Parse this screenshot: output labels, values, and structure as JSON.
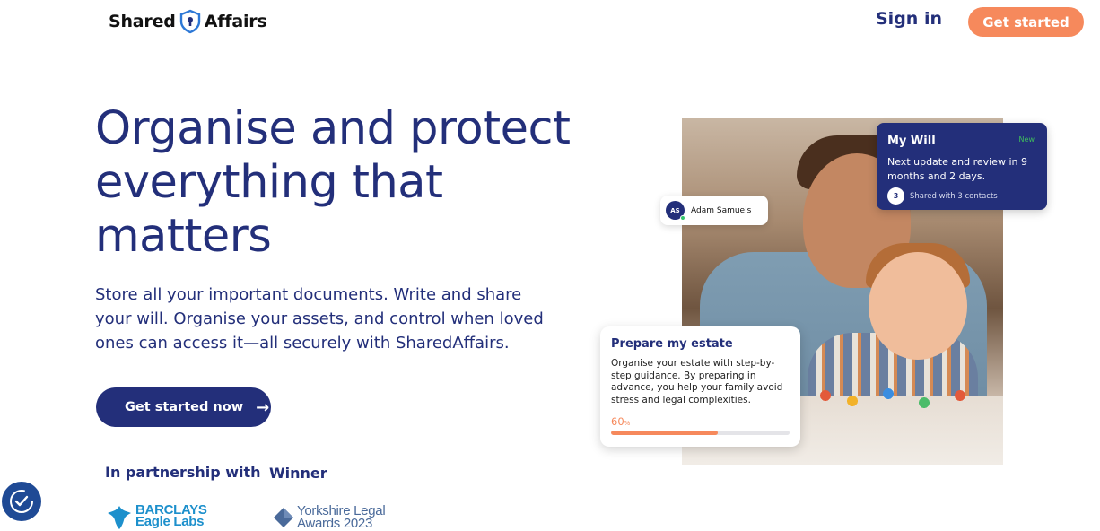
{
  "header": {
    "logo_left": "Shared",
    "logo_right": "Affairs",
    "logo_icon": "shield-keyhole-icon",
    "signin_label": "Sign in",
    "getstarted_label": "Get started"
  },
  "hero": {
    "title": "Organise and protect everything that matters",
    "subtitle": "Store all your important documents. Write and share your will. Organise your assets, and control when loved ones can access it—all securely with SharedAffairs.",
    "cta_label": "Get started now",
    "cta_icon": "arrow-right-icon"
  },
  "trust": {
    "partnership_label": "In partnership with",
    "winner_label": "Winner",
    "barclays_line1": "BARCLAYS",
    "barclays_line2": "Eagle Labs",
    "yorkshire_line1": "Yorkshire Legal",
    "yorkshire_line2": "Awards 2023"
  },
  "user_pill": {
    "initials": "AS",
    "name": "Adam Samuels"
  },
  "will_card": {
    "title": "My Will",
    "badge": "New",
    "text": "Next update and review in 9 months and 2 days.",
    "shared_count": "3",
    "shared_text": "Shared with 3 contacts"
  },
  "estate_card": {
    "title": "Prepare my estate",
    "text": "Organise your estate with step-by-step guidance. By preparing in advance, you help your family avoid stress and legal complexities.",
    "percent_value": "60",
    "percent_unit": "%",
    "progress": 0.6
  },
  "colors": {
    "brand_navy": "#232f7a",
    "accent_orange": "#f6895c",
    "status_green": "#3fbf5c"
  },
  "badge_icon": "accessibility-check-icon"
}
